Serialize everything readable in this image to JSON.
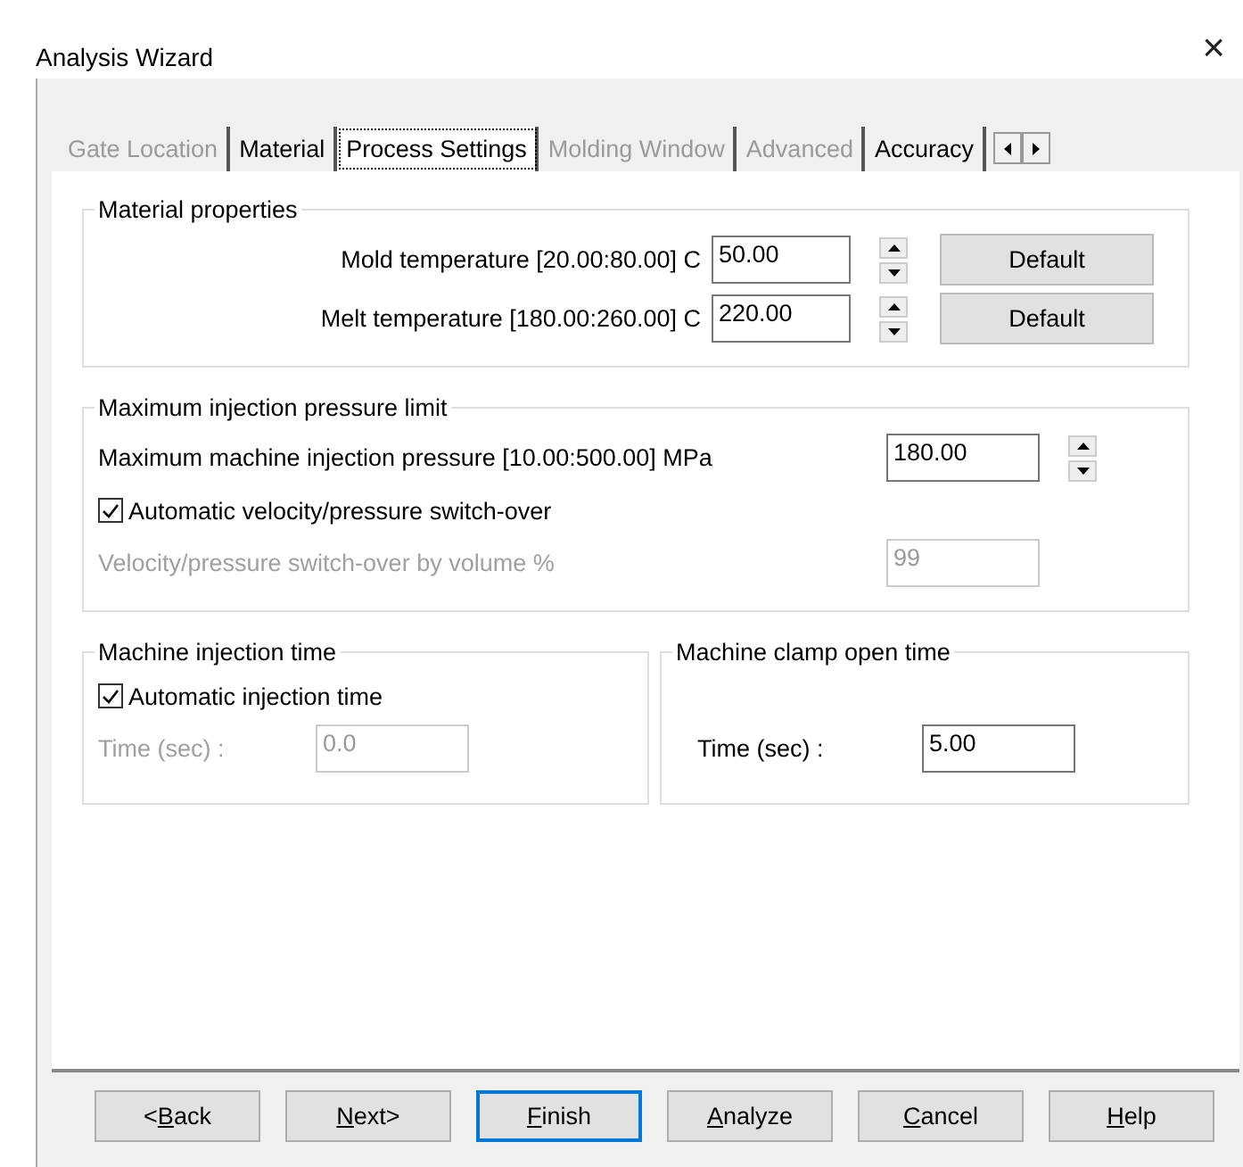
{
  "window": {
    "title": "Analysis Wizard",
    "close": "×"
  },
  "tabs": [
    {
      "label": "Gate Location",
      "selected": false,
      "disabled": true
    },
    {
      "label": "Material",
      "selected": false,
      "disabled": false
    },
    {
      "label": "Process Settings",
      "selected": true,
      "disabled": false
    },
    {
      "label": "Molding Window",
      "selected": false,
      "disabled": true
    },
    {
      "label": "Advanced",
      "selected": false,
      "disabled": true
    },
    {
      "label": "Accuracy",
      "selected": false,
      "disabled": false
    }
  ],
  "material_properties": {
    "title": "Material properties",
    "rows": [
      {
        "label": "Mold temperature [20.00:80.00] C",
        "value": "50.00",
        "button": "Default"
      },
      {
        "label": "Melt temperature [180.00:260.00] C",
        "value": "220.00",
        "button": "Default"
      }
    ]
  },
  "pressure_limit": {
    "title": "Maximum injection pressure limit",
    "label": "Maximum machine injection pressure [10.00:500.00] MPa",
    "value": "180.00",
    "switch_over": {
      "label": "Automatic velocity/pressure switch-over",
      "checked": true
    },
    "volume": {
      "label": "Velocity/pressure switch-over by volume %",
      "value": "99",
      "disabled": true
    }
  },
  "injection_time": {
    "title": "Machine injection time",
    "auto": {
      "label": "Automatic injection time",
      "checked": true
    },
    "time": {
      "label": "Time (sec) :",
      "value": "0.0",
      "disabled": true
    }
  },
  "clamp_open_time": {
    "title": "Machine clamp open time",
    "time": {
      "label": "Time (sec) :",
      "value": "5.00",
      "disabled": false
    }
  },
  "buttons": [
    {
      "pre": "<",
      "key": "B",
      "post": "ack",
      "default": false
    },
    {
      "key": "N",
      "post": "ext>",
      "default": false
    },
    {
      "key": "F",
      "post": "inish",
      "default": true
    },
    {
      "key": "A",
      "post": "nalyze",
      "default": false
    },
    {
      "key": "C",
      "post": "ancel",
      "default": false
    },
    {
      "key": "H",
      "post": "elp",
      "default": false
    }
  ]
}
